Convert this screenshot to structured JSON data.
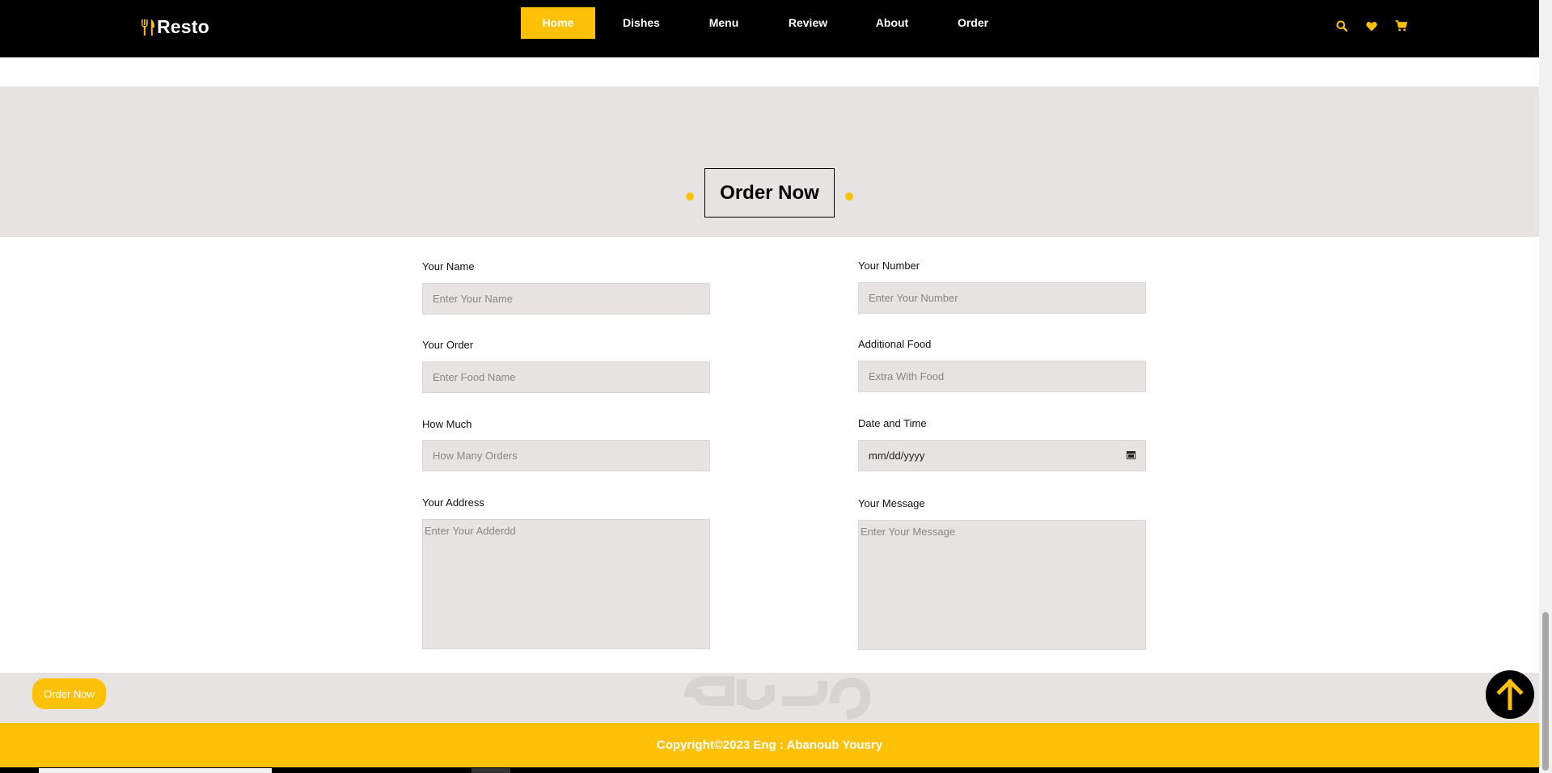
{
  "header": {
    "logo_text": "Resto",
    "nav": [
      {
        "label": "Home",
        "active": true
      },
      {
        "label": "Dishes",
        "active": false
      },
      {
        "label": "Menu",
        "active": false
      },
      {
        "label": "Review",
        "active": false
      },
      {
        "label": "About",
        "active": false
      },
      {
        "label": "Order",
        "active": false
      }
    ],
    "icons": [
      "search-icon",
      "heart-icon",
      "cart-icon"
    ]
  },
  "section": {
    "heading": "Order Now"
  },
  "form": {
    "name": {
      "label": "Your Name",
      "placeholder": "Enter Your Name"
    },
    "number": {
      "label": "Your Number",
      "placeholder": "Enter Your Number"
    },
    "order": {
      "label": "Your Order",
      "placeholder": "Enter Food Name"
    },
    "additional": {
      "label": "Additional Food",
      "placeholder": "Extra With Food"
    },
    "how_much": {
      "label": "How Much",
      "placeholder": "How Many Orders"
    },
    "datetime": {
      "label": "Date and Time",
      "value": "mm/dd/yyyy"
    },
    "address": {
      "label": "Your Address",
      "placeholder": "Enter Your Adderdd"
    },
    "message": {
      "label": "Your Message",
      "placeholder": "Enter Your Message"
    },
    "submit_label": "Order Now"
  },
  "footer": {
    "copyright": "Copyright©2023 Eng : Abanoub Yousry"
  },
  "colors": {
    "accent": "#ffc107",
    "header_bg": "#000000",
    "section_bg": "#e6e3e2"
  }
}
